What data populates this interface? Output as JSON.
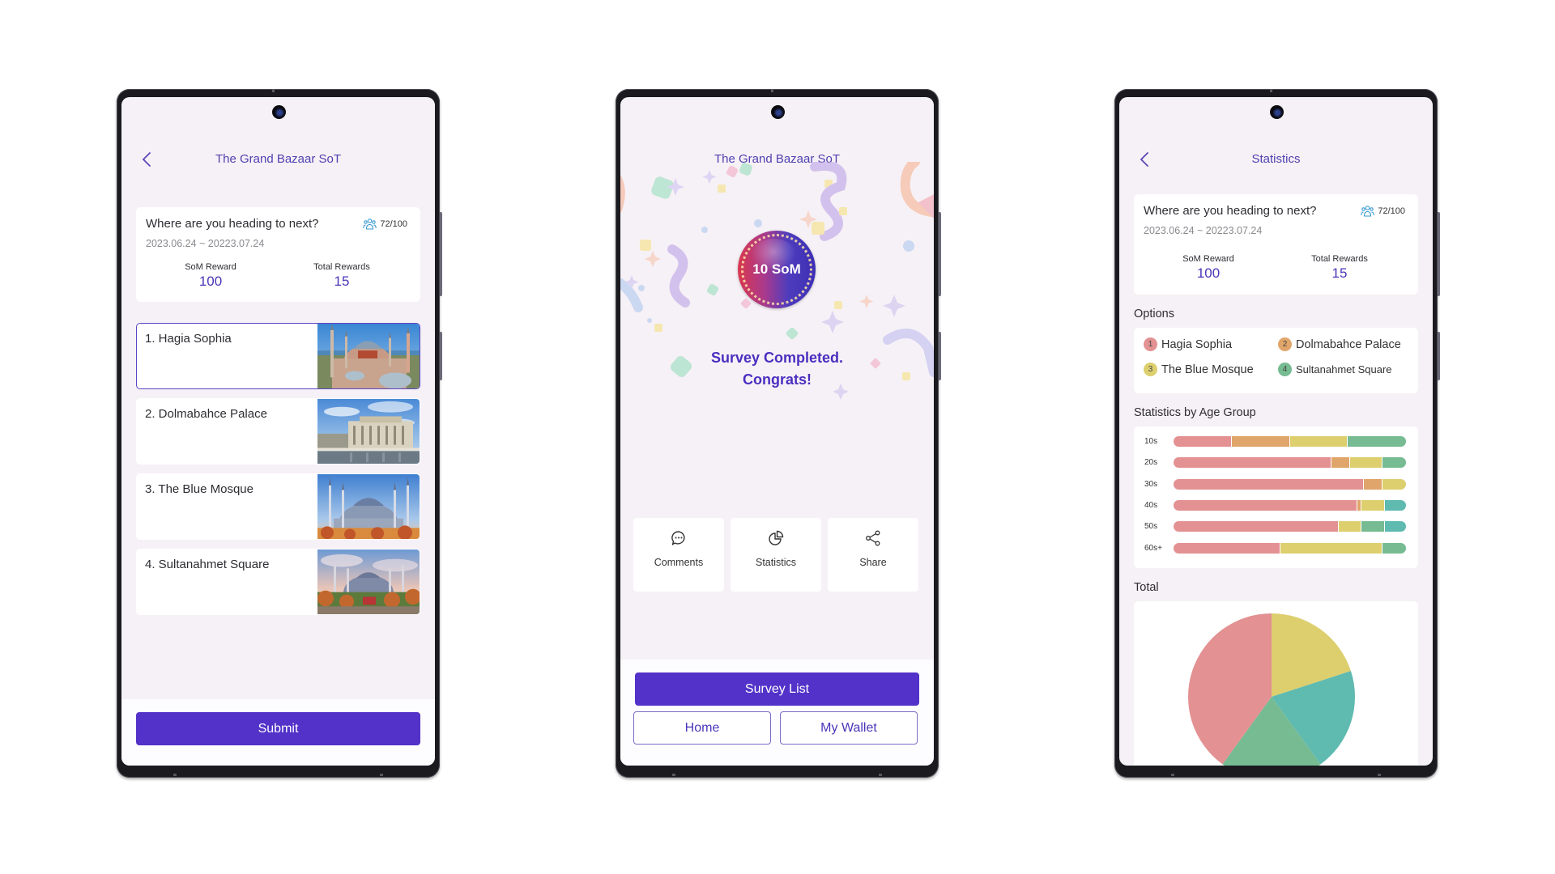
{
  "colors": {
    "accent": "#5232c8",
    "title": "#5040b0",
    "value": "#4a36b8",
    "option_1": "#e39192",
    "option_2": "#e0a56a",
    "option_3": "#ddcf6e",
    "option_4": "#76bb92",
    "option_5": "#5fbab0"
  },
  "survey": {
    "question": "Where are you heading to next?",
    "dates": "2023.06.24 ~ 20223.07.24",
    "participants": "72/100",
    "participants_icon": "people-icon",
    "som_reward_label": "SoM Reward",
    "som_reward_value": "100",
    "total_rewards_label": "Total Rewards",
    "total_rewards_value": "15"
  },
  "screen1": {
    "title": "The Grand Bazaar SoT",
    "back_icon": "chevron-left-icon",
    "options": [
      {
        "label": "1. Hagia Sophia",
        "selected": true,
        "image": "hagia-sophia-photo"
      },
      {
        "label": "2. Dolmabahce Palace",
        "selected": false,
        "image": "dolmabahce-palace-photo"
      },
      {
        "label": "3. The Blue Mosque",
        "selected": false,
        "image": "blue-mosque-photo"
      },
      {
        "label": "4. Sultanahmet Square",
        "selected": false,
        "image": "sultanahmet-square-photo"
      }
    ],
    "submit_label": "Submit"
  },
  "screen2": {
    "title": "The Grand Bazaar SoT",
    "reward_badge": "10 SoM",
    "message_line1": "Survey Completed.",
    "message_line2": "Congrats!",
    "actions": [
      {
        "label": "Comments",
        "icon": "comment-icon"
      },
      {
        "label": "Statistics",
        "icon": "pie-chart-icon"
      },
      {
        "label": "Share",
        "icon": "share-icon"
      }
    ],
    "survey_list_label": "Survey List",
    "home_label": "Home",
    "wallet_label": "My Wallet"
  },
  "screen3": {
    "title": "Statistics",
    "back_icon": "chevron-left-icon",
    "options_label": "Options",
    "options": [
      {
        "num": "1",
        "name": "Hagia Sophia"
      },
      {
        "num": "2",
        "name": "Dolmabahce Palace"
      },
      {
        "num": "3",
        "name": "The Blue Mosque"
      },
      {
        "num": "4",
        "name": "Sultanahmet Square"
      }
    ],
    "age_label": "Statistics by Age Group",
    "total_label": "Total"
  },
  "chart_data": [
    {
      "type": "bar",
      "orientation": "horizontal-stacked-100",
      "title": "Statistics by Age Group",
      "categories": [
        "10s",
        "20s",
        "30s",
        "40s",
        "50s",
        "60s+"
      ],
      "segments": [
        [
          {
            "color": "option_1",
            "value": 25
          },
          {
            "color": "option_2",
            "value": 25
          },
          {
            "color": "option_3",
            "value": 25
          },
          {
            "color": "option_4",
            "value": 25
          }
        ],
        [
          {
            "color": "option_1",
            "value": 68
          },
          {
            "color": "option_2",
            "value": 8
          },
          {
            "color": "option_3",
            "value": 14
          },
          {
            "color": "option_4",
            "value": 10
          }
        ],
        [
          {
            "color": "option_1",
            "value": 82
          },
          {
            "color": "option_2",
            "value": 8
          },
          {
            "color": "option_3",
            "value": 10
          }
        ],
        [
          {
            "color": "option_1",
            "value": 79
          },
          {
            "color": "option_2",
            "value": 2
          },
          {
            "color": "option_3",
            "value": 10
          },
          {
            "color": "option_5",
            "value": 9
          }
        ],
        [
          {
            "color": "option_1",
            "value": 71
          },
          {
            "color": "option_3",
            "value": 10
          },
          {
            "color": "option_4",
            "value": 10
          },
          {
            "color": "option_5",
            "value": 9
          }
        ],
        [
          {
            "color": "option_1",
            "value": 46
          },
          {
            "color": "option_3",
            "value": 44
          },
          {
            "color": "option_4",
            "value": 10
          }
        ]
      ],
      "unit": "percent"
    },
    {
      "type": "pie",
      "title": "Total",
      "start": "12 o'clock, clockwise",
      "slices": [
        {
          "color": "option_3",
          "value": 20
        },
        {
          "color": "option_5",
          "value": 20
        },
        {
          "color": "option_4",
          "value": 20
        },
        {
          "color": "option_1",
          "value": 40
        }
      ],
      "unit": "percent"
    }
  ]
}
